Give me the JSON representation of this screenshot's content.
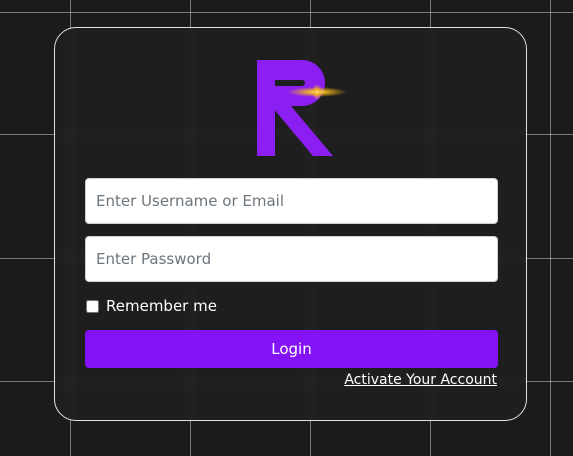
{
  "login_form": {
    "username_placeholder": "Enter Username or Email",
    "password_placeholder": "Enter Password",
    "remember_label": "Remember me",
    "remember_checked": false,
    "login_label": "Login",
    "activate_label": "Activate Your Account"
  },
  "colors": {
    "background": "#1b1b1b",
    "accent": "#8312f5",
    "logo": "#8b1ff2",
    "logo_glow": "#f5b51a"
  },
  "logo": {
    "icon": "r-letter-logo-icon"
  }
}
